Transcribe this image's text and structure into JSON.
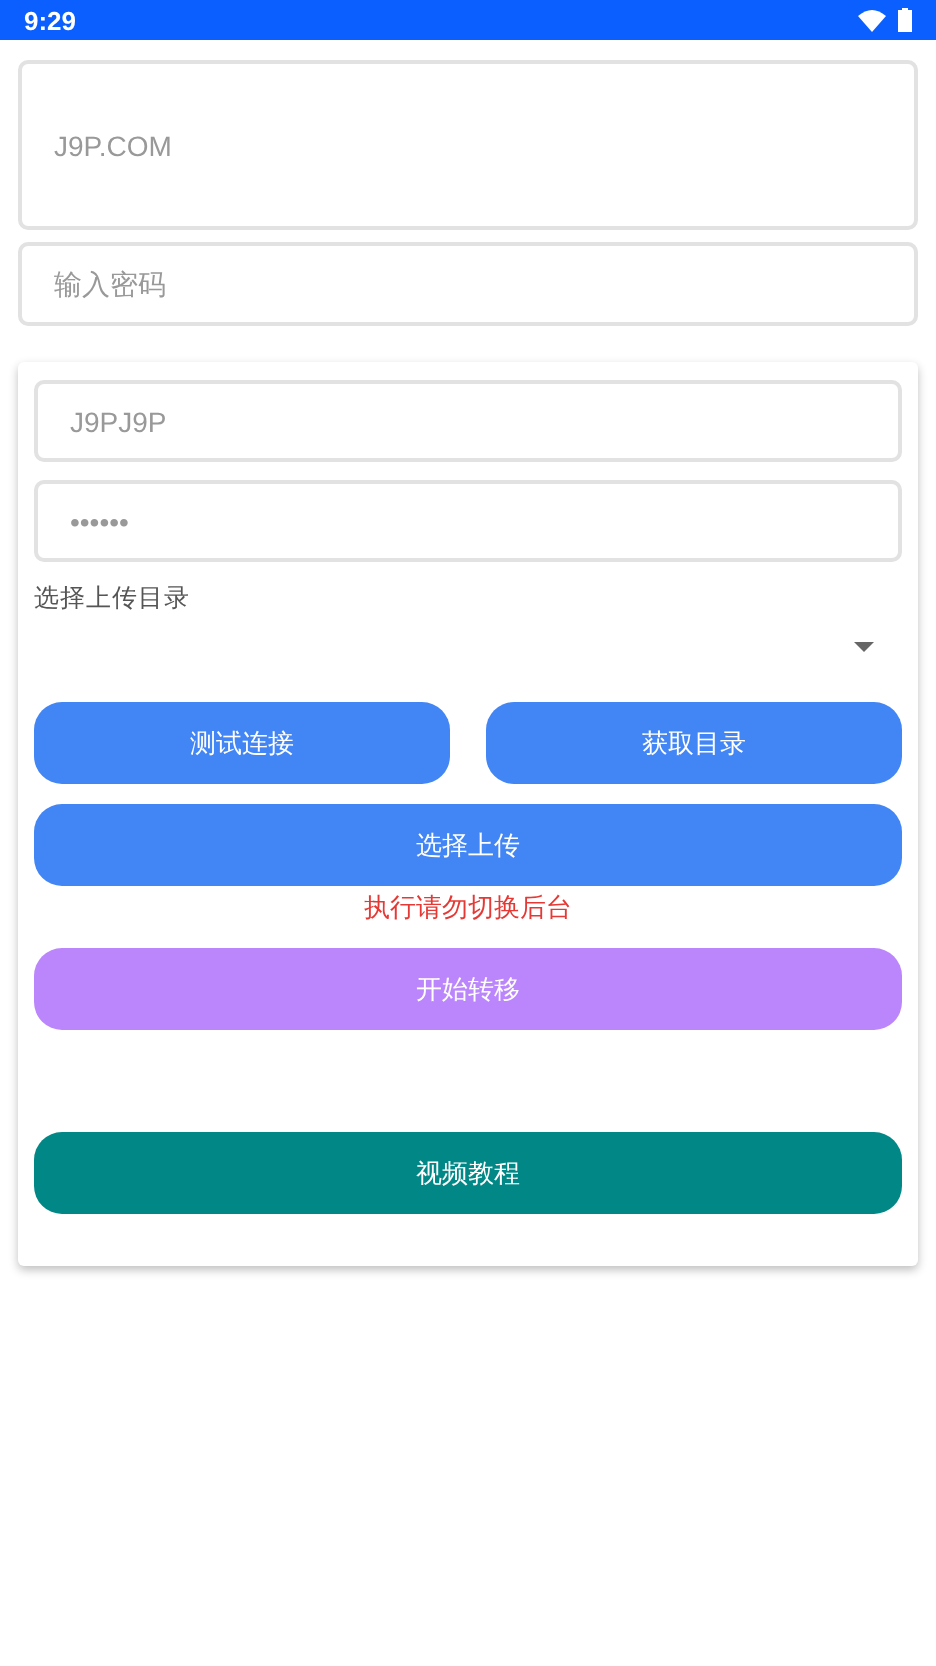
{
  "status_bar": {
    "time": "9:29"
  },
  "server_field": {
    "value": "J9P.COM"
  },
  "password_field": {
    "placeholder": "输入密码"
  },
  "card": {
    "account_field": {
      "value": "J9PJ9P"
    },
    "secret_field": {
      "value": "••••••"
    },
    "directory_label": "选择上传目录",
    "button_row": [
      {
        "label": "测试连接",
        "color": "#4285f4"
      },
      {
        "label": "获取目录",
        "color": "#4285f4"
      }
    ],
    "upload_button": {
      "label": "选择上传",
      "color": "#4285f4"
    },
    "warning": "执行请勿切换后台",
    "transfer_button": {
      "label": "开始转移",
      "color": "#bb86fc"
    },
    "tutorial_button": {
      "label": "视频教程",
      "color": "#018786"
    }
  }
}
